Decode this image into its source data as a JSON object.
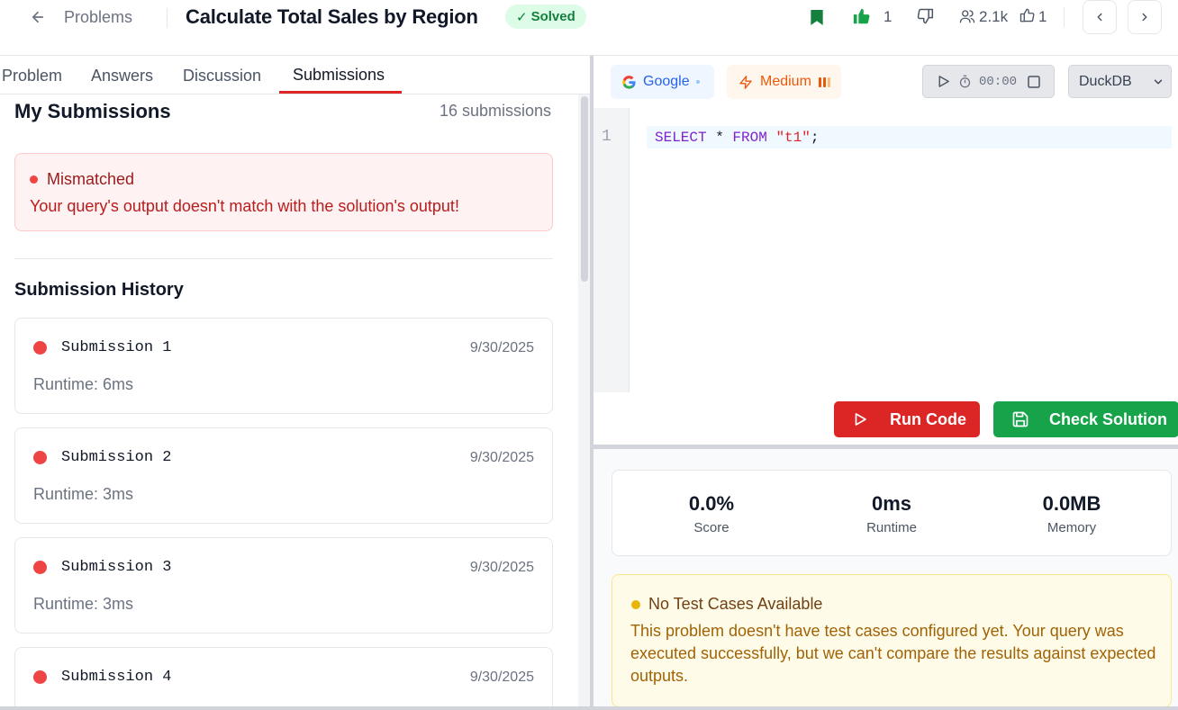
{
  "header": {
    "back_label": "Problems",
    "title": "Calculate Total Sales by Region",
    "solved_badge": "Solved",
    "likes": "1",
    "users_count": "2.1k",
    "thumbs_count": "1"
  },
  "tabs": [
    {
      "label": "Problem"
    },
    {
      "label": "Answers"
    },
    {
      "label": "Discussion"
    },
    {
      "label": "Submissions",
      "active": true
    }
  ],
  "submissions": {
    "heading": "My Submissions",
    "count_label": "16 submissions",
    "alert": {
      "title": "Mismatched",
      "message": "Your query's output doesn't match with the solution's output!"
    },
    "history_heading": "Submission History",
    "items": [
      {
        "name": "Submission 1",
        "date": "9/30/2025",
        "runtime": "Runtime: 6ms"
      },
      {
        "name": "Submission 2",
        "date": "9/30/2025",
        "runtime": "Runtime: 3ms"
      },
      {
        "name": "Submission 3",
        "date": "9/30/2025",
        "runtime": "Runtime: 3ms"
      },
      {
        "name": "Submission 4",
        "date": "9/30/2025",
        "runtime": ""
      }
    ]
  },
  "editor": {
    "company": "Google",
    "difficulty": "Medium",
    "timer": "00:00",
    "language": "DuckDB",
    "line_number": "1",
    "code": {
      "kw1": "SELECT",
      "mid": " * ",
      "kw2": "FROM",
      "space": " ",
      "str": "\"t1\"",
      "end": ";"
    },
    "run_label": "Run Code",
    "check_label": "Check Solution"
  },
  "results": {
    "score": {
      "value": "0.0%",
      "label": "Score"
    },
    "runtime": {
      "value": "0ms",
      "label": "Runtime"
    },
    "memory": {
      "value": "0.0MB",
      "label": "Memory"
    },
    "notice": {
      "title": "No Test Cases Available",
      "message": "This problem doesn't have test cases configured yet. Your query was executed successfully, but we can't compare the results against expected outputs."
    }
  },
  "colors": {
    "accent_red": "#dc2626",
    "accent_green": "#16a34a",
    "google_blue": "#2563eb",
    "medium_orange": "#ea580c"
  },
  "icons": [
    "back-arrow-icon",
    "bookmark-icon",
    "thumbs-up-icon",
    "thumbs-down-icon",
    "users-icon",
    "chevron-left-icon",
    "chevron-right-icon",
    "google-icon",
    "bolt-icon",
    "play-icon",
    "stopwatch-icon",
    "stop-icon",
    "chevron-down-icon",
    "save-icon"
  ]
}
